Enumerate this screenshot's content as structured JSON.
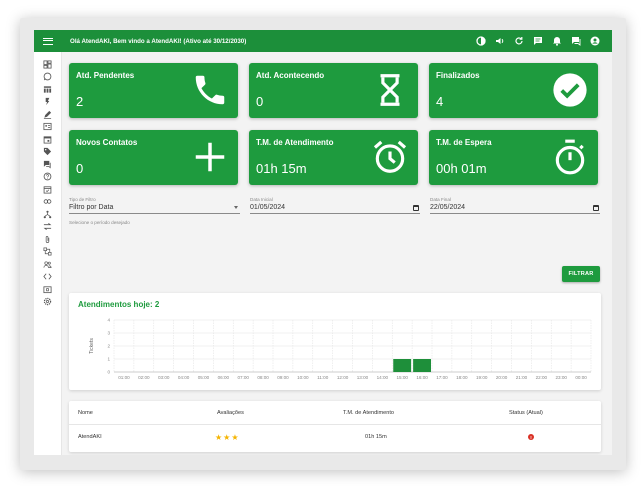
{
  "header": {
    "greeting": "Olá AtendAKI, Bem vindo a AtendAKI! (Ativo até 30/12/2030)",
    "icons": [
      "brightness-icon",
      "volume-icon",
      "refresh-icon",
      "chat-icon",
      "bell-icon",
      "messages-icon",
      "account-icon"
    ]
  },
  "sidebar": {
    "icons": [
      "dashboard-icon",
      "whatsapp-icon",
      "columns-icon",
      "flash-icon",
      "edit-icon",
      "contacts-icon",
      "calendar-icon",
      "tag-icon",
      "chat-icon",
      "help-icon",
      "schedule-icon",
      "link-icon",
      "hierarchy-icon",
      "swap-icon",
      "attachment-icon",
      "integration-icon",
      "users-icon",
      "code-icon",
      "wallet-icon",
      "settings-icon"
    ]
  },
  "cards": [
    {
      "title": "Atd. Pendentes",
      "value": "2",
      "icon": "phone-icon"
    },
    {
      "title": "Atd. Acontecendo",
      "value": "0",
      "icon": "hourglass-icon"
    },
    {
      "title": "Finalizados",
      "value": "4",
      "icon": "check-circle-icon"
    },
    {
      "title": "Novos Contatos",
      "value": "0",
      "icon": "plus-icon"
    },
    {
      "title": "T.M. de Atendimento",
      "value": "01h 15m",
      "icon": "alarm-icon"
    },
    {
      "title": "T.M. de Espera",
      "value": "00h 01m",
      "icon": "timer-icon"
    }
  ],
  "filters": {
    "type_label": "Tipo de Filtro",
    "type_value": "Filtro por Data",
    "type_helper": "Selecione o período desejado",
    "start_label": "Data Inicial",
    "start_value": "01/05/2024",
    "end_label": "Data Final",
    "end_value": "22/05/2024",
    "button": "FILTRAR"
  },
  "chart_data": {
    "type": "bar",
    "title": "Atendimentos hoje: 2",
    "ylabel": "Tickets",
    "xlabel": "",
    "categories": [
      "01:00",
      "02:00",
      "03:00",
      "04:00",
      "05:00",
      "06:00",
      "07:00",
      "08:00",
      "09:00",
      "10:00",
      "11:00",
      "12:00",
      "13:00",
      "14:00",
      "15:00",
      "16:00",
      "17:00",
      "18:00",
      "19:00",
      "20:00",
      "21:00",
      "22:00",
      "23:00",
      "00:00"
    ],
    "values": [
      0,
      0,
      0,
      0,
      0,
      0,
      0,
      0,
      0,
      0,
      0,
      0,
      0,
      0,
      1,
      1,
      0,
      0,
      0,
      0,
      0,
      0,
      0,
      0
    ],
    "ylim": [
      0,
      4
    ],
    "yticks": [
      "0",
      "1",
      "2",
      "3",
      "4"
    ],
    "grid": true,
    "bar_color": "#1e8f3a"
  },
  "table": {
    "headers": [
      "Nome",
      "Avaliações",
      "T.M. de Atendimento",
      "Status (Atual)"
    ],
    "rows": [
      {
        "name": "AtendAKI",
        "stars": "★★★",
        "tm": "01h 15m",
        "status": "!"
      }
    ]
  }
}
